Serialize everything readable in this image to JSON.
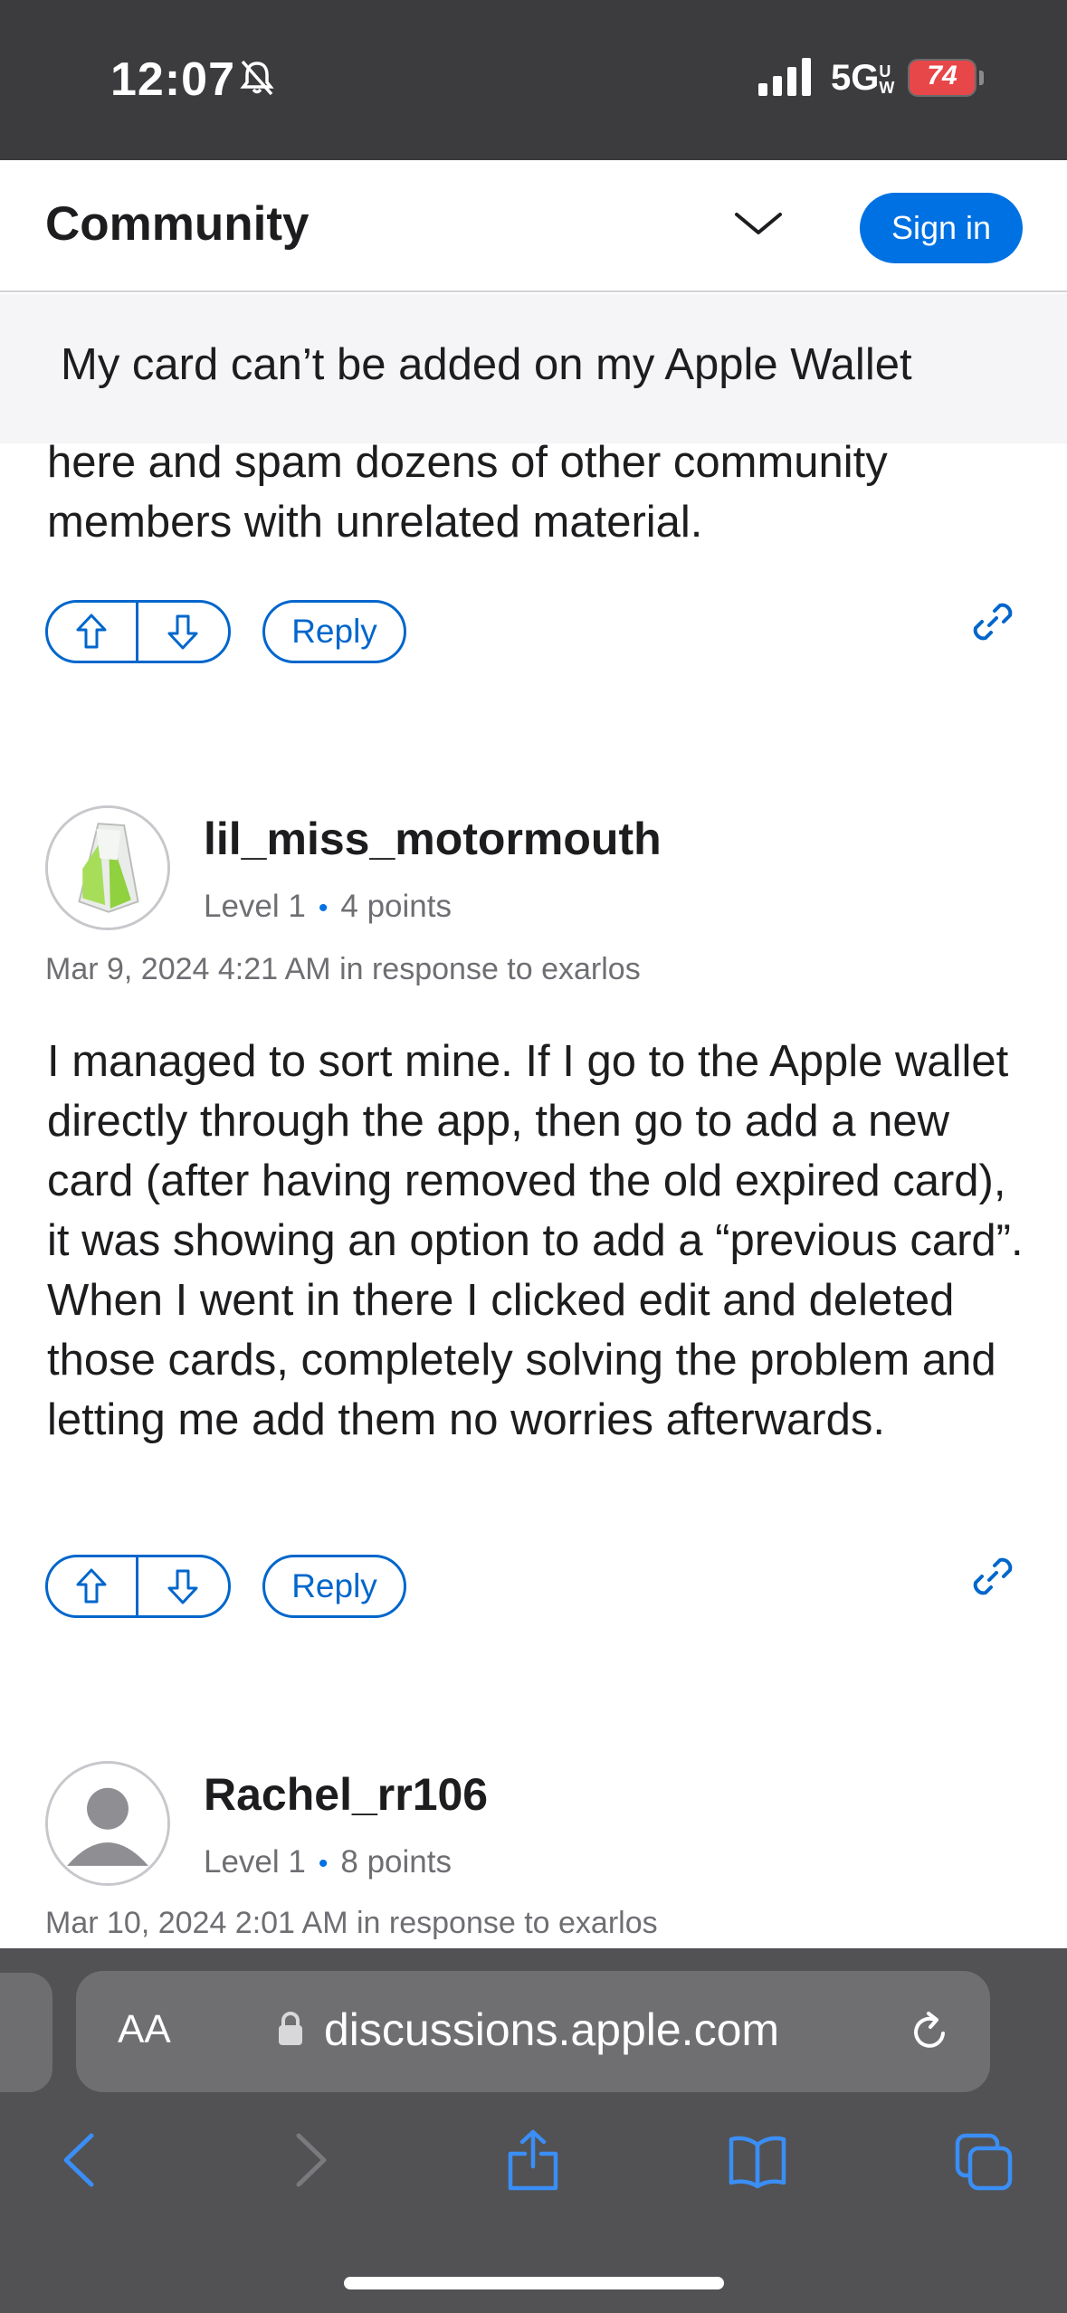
{
  "status_bar": {
    "time": "12:07",
    "network": "5G",
    "network_suffix": "UW",
    "battery_level": "74"
  },
  "header": {
    "title": "Community",
    "sign_in_label": "Sign in"
  },
  "thread": {
    "title": "My card can’t be added on my Apple Wallet"
  },
  "posts": [
    {
      "body": "here and spam dozens of other community members with unrelated material.",
      "reply_label": "Reply"
    },
    {
      "username": "lil_miss_motormouth",
      "level": "Level 1",
      "points": "4 points",
      "meta": "Mar 9, 2024 4:21 AM in response to exarlos",
      "body": "I managed to sort mine. If I go to the Apple wallet directly through the app, then go to add a new card (after having removed the old expired card), it was showing an option to add a “previous card”. When I went in there I clicked edit and deleted those cards, completely solving the problem and letting me add them no worries afterwards.",
      "reply_label": "Reply"
    },
    {
      "username": "Rachel_rr106",
      "level": "Level 1",
      "points": "8 points",
      "meta": "Mar 10, 2024 2:01 AM in response to exarlos"
    }
  ],
  "browser": {
    "text_size_label": "AA",
    "url": "discussions.apple.com"
  },
  "colors": {
    "accent": "#0071e3",
    "link": "#0066cc",
    "status_bar_bg": "#3c3c3e",
    "browser_bg": "#525254"
  }
}
